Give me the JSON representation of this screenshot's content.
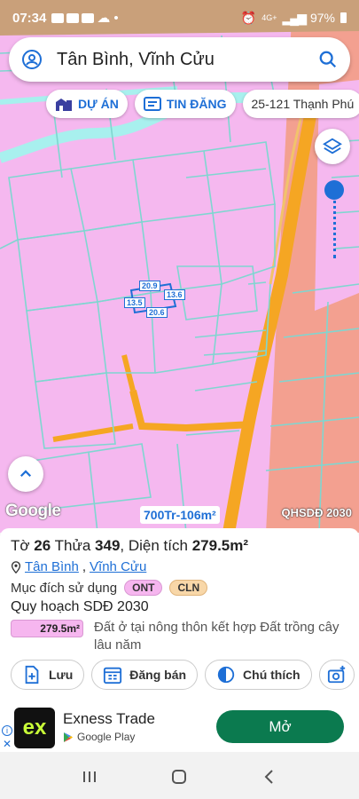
{
  "status_bar": {
    "time": "07:34",
    "network": "4G+",
    "battery": "97%"
  },
  "search": {
    "title": "Tân Bình, Vĩnh Cửu"
  },
  "chips": [
    {
      "label": "DỰ ÁN"
    },
    {
      "label": "TIN ĐĂNG"
    },
    {
      "label": "25-121 Thạnh Phú"
    }
  ],
  "map": {
    "plot_edges": [
      "20.9",
      "13.6",
      "20.6",
      "13.5"
    ],
    "google_label": "Google",
    "price_label": "700Tr-106m²",
    "plan_label": "QHSDĐ 2030",
    "colors": {
      "residential": "#f5b8ef",
      "road": "#f5a623",
      "parcel_line": "#7fd6d0",
      "accent": "#1e6fd6"
    }
  },
  "parcel": {
    "to_label": "Tờ",
    "to_value": "26",
    "thua_label": "Thửa",
    "thua_value": "349",
    "area_label": "Diện tích",
    "area_value": "279.5m²",
    "commune": "Tân Bình",
    "district": "Vĩnh Cửu",
    "purpose_label": "Mục đích sử dụng",
    "purpose_tags": [
      "ONT",
      "CLN"
    ],
    "plan_title": "Quy hoạch SDĐ 2030",
    "plan_area": "279.5m²",
    "plan_desc": "Đất ở tại nông thôn kết hợp Đất trồng cây lâu năm"
  },
  "actions": {
    "save": "Lưu",
    "sell": "Đăng bán",
    "legend": "Chú thích"
  },
  "ad": {
    "logo_text": "ex",
    "name": "Exness Trade",
    "store": "Google Play",
    "open": "Mở"
  }
}
